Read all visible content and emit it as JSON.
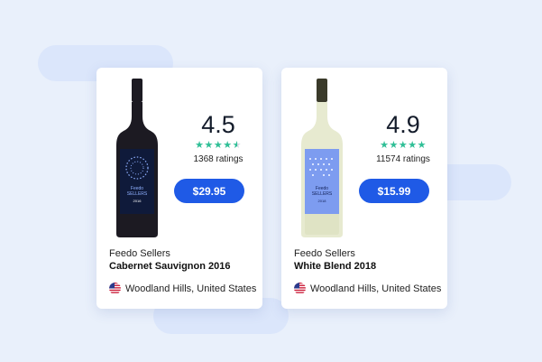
{
  "theme": {
    "accent": "#1f5ae6",
    "star_color": "#2fbf96",
    "background": "#e9f0fb"
  },
  "wines": [
    {
      "rating": "4.5",
      "rating_value": 4.5,
      "ratings_count": "1368 ratings",
      "price": "$29.95",
      "seller": "Feedo Sellers",
      "name": "Cabernet Sauvignon 2016",
      "location": "Woodland Hills, United States",
      "flag_icon": "us-flag-icon",
      "bottle": {
        "type": "red",
        "glass_color": "#1c1a22",
        "label_color": "#0f1a3a"
      },
      "bottle_label": {
        "brand_line1": "Feedo",
        "brand_line2": "SELLERS",
        "year": "2016"
      }
    },
    {
      "rating": "4.9",
      "rating_value": 4.9,
      "ratings_count": "11574 ratings",
      "price": "$15.99",
      "seller": "Feedo Sellers",
      "name": "White Blend 2018",
      "location": "Woodland Hills, United States",
      "flag_icon": "us-flag-icon",
      "bottle": {
        "type": "white",
        "glass_color": "#e7ead0",
        "label_color": "#7d9cf0"
      },
      "bottle_label": {
        "brand_line1": "Feedo",
        "brand_line2": "SELLERS",
        "year": "2018"
      }
    }
  ]
}
